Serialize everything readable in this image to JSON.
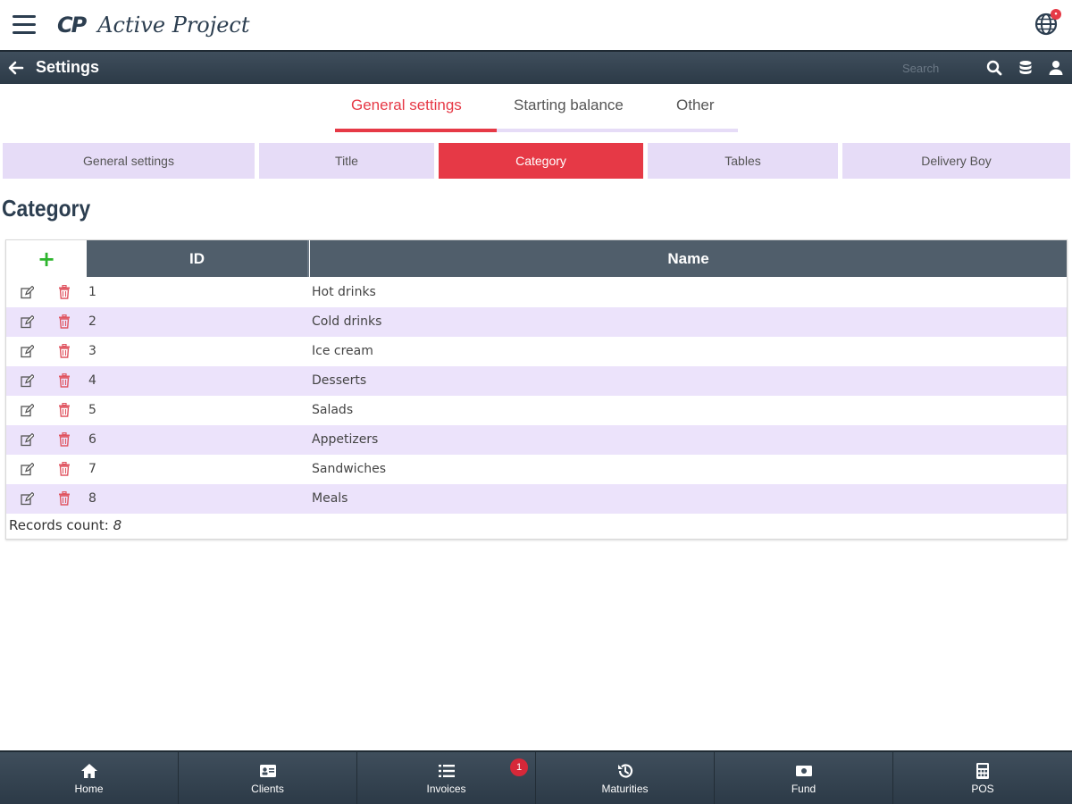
{
  "header": {
    "logo_mark": "CP",
    "logo_text": "Active Project",
    "globe_badge": "•"
  },
  "titlebar": {
    "title": "Settings",
    "search_placeholder": "Search"
  },
  "main_tabs": [
    {
      "label": "General settings",
      "active": true
    },
    {
      "label": "Starting balance",
      "active": false
    },
    {
      "label": "Other",
      "active": false
    }
  ],
  "sub_tabs": [
    {
      "label": "General settings",
      "active": false
    },
    {
      "label": "Title",
      "active": false
    },
    {
      "label": "Category",
      "active": true
    },
    {
      "label": "Tables",
      "active": false
    },
    {
      "label": "Delivery Boy",
      "active": false
    }
  ],
  "section_title": "Category",
  "table": {
    "add_symbol": "+",
    "columns": [
      "ID",
      "Name"
    ],
    "rows": [
      {
        "id": "1",
        "name": "Hot drinks"
      },
      {
        "id": "2",
        "name": "Cold drinks"
      },
      {
        "id": "3",
        "name": "Ice cream"
      },
      {
        "id": "4",
        "name": "Desserts"
      },
      {
        "id": "5",
        "name": "Salads"
      },
      {
        "id": "6",
        "name": "Appetizers"
      },
      {
        "id": "7",
        "name": "Sandwiches"
      },
      {
        "id": "8",
        "name": "Meals"
      }
    ],
    "records_label": "Records count:",
    "records_count": "8"
  },
  "bottom_nav": [
    {
      "label": "Home",
      "icon": "home-icon"
    },
    {
      "label": "Clients",
      "icon": "id-card-icon"
    },
    {
      "label": "Invoices",
      "icon": "list-icon",
      "badge": "1"
    },
    {
      "label": "Maturities",
      "icon": "history-icon"
    },
    {
      "label": "Fund",
      "icon": "cash-icon"
    },
    {
      "label": "POS",
      "icon": "calculator-icon"
    }
  ],
  "colors": {
    "accent": "#e63946",
    "header_dark": "#2c3a47",
    "tab_bg": "#e6dcf7",
    "row_alt": "#ece3fb",
    "add_green": "#2db52d"
  }
}
